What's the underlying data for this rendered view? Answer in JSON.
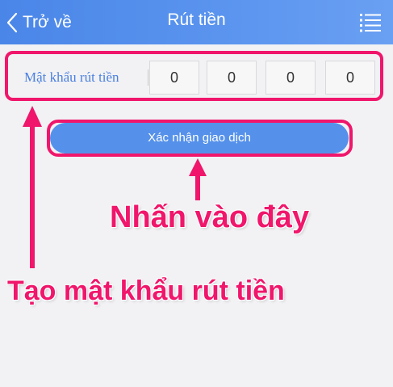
{
  "header": {
    "back_label": "Trở về",
    "title": "Rút tiền",
    "back_icon": "chevron-left-icon",
    "menu_icon": "list-menu-icon"
  },
  "password": {
    "label": "Mật khẩu rút tiền",
    "digits": [
      "0",
      "0",
      "0",
      "0"
    ]
  },
  "confirm_button": {
    "label": "Xác nhận giao dịch"
  },
  "annotations": {
    "click_here": "Nhấn vào đây",
    "create_password": "Tạo mật khẩu rút tiền"
  },
  "colors": {
    "header_bg": "#4a86e8",
    "button_bg": "#5591ea",
    "label_text": "#4a7fe0",
    "annotation": "#f0166b",
    "page_bg": "#f2f2f4"
  }
}
